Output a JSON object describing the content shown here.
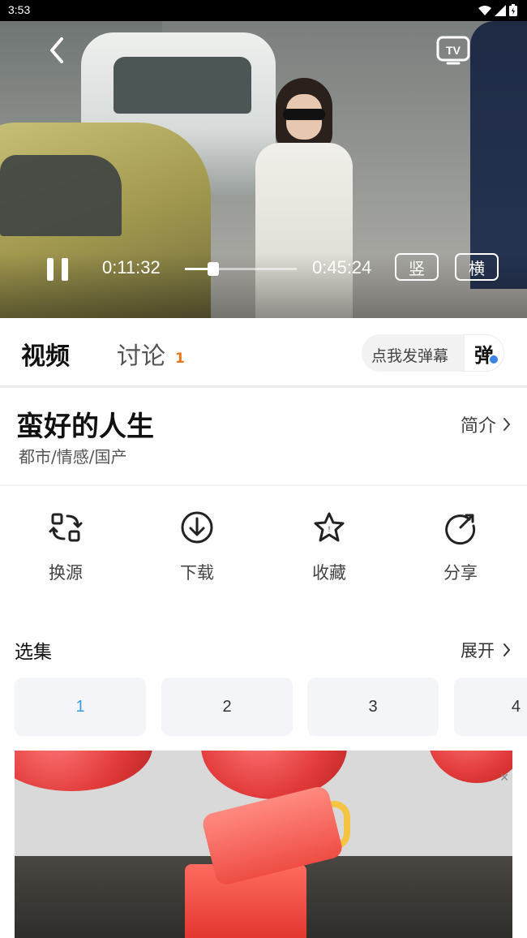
{
  "status_bar": {
    "time": "3:53"
  },
  "player": {
    "current_time": "0:11:32",
    "duration": "0:45:24",
    "progress": 0.254,
    "portrait_label": "竖",
    "landscape_label": "横"
  },
  "tabs": {
    "video_label": "视频",
    "discussion_label": "讨论",
    "discussion_count": "1",
    "danmu_placeholder": "点我发弹幕",
    "danmu_button": "弹"
  },
  "show": {
    "title": "蛮好的人生",
    "genre": "都市/情感/国产",
    "intro_label": "简介"
  },
  "actions": [
    {
      "label": "换源",
      "icon": "switch-source-icon"
    },
    {
      "label": "下载",
      "icon": "download-icon"
    },
    {
      "label": "收藏",
      "icon": "favorite-star-icon"
    },
    {
      "label": "分享",
      "icon": "share-icon"
    }
  ],
  "episodes": {
    "title": "选集",
    "expand_label": "展开",
    "items": [
      "1",
      "2",
      "3",
      "4"
    ],
    "active": "1"
  },
  "colors": {
    "accent_orange": "#e8741e",
    "active_episode": "#3a9be6",
    "verified_badge": "#3a86e8"
  }
}
